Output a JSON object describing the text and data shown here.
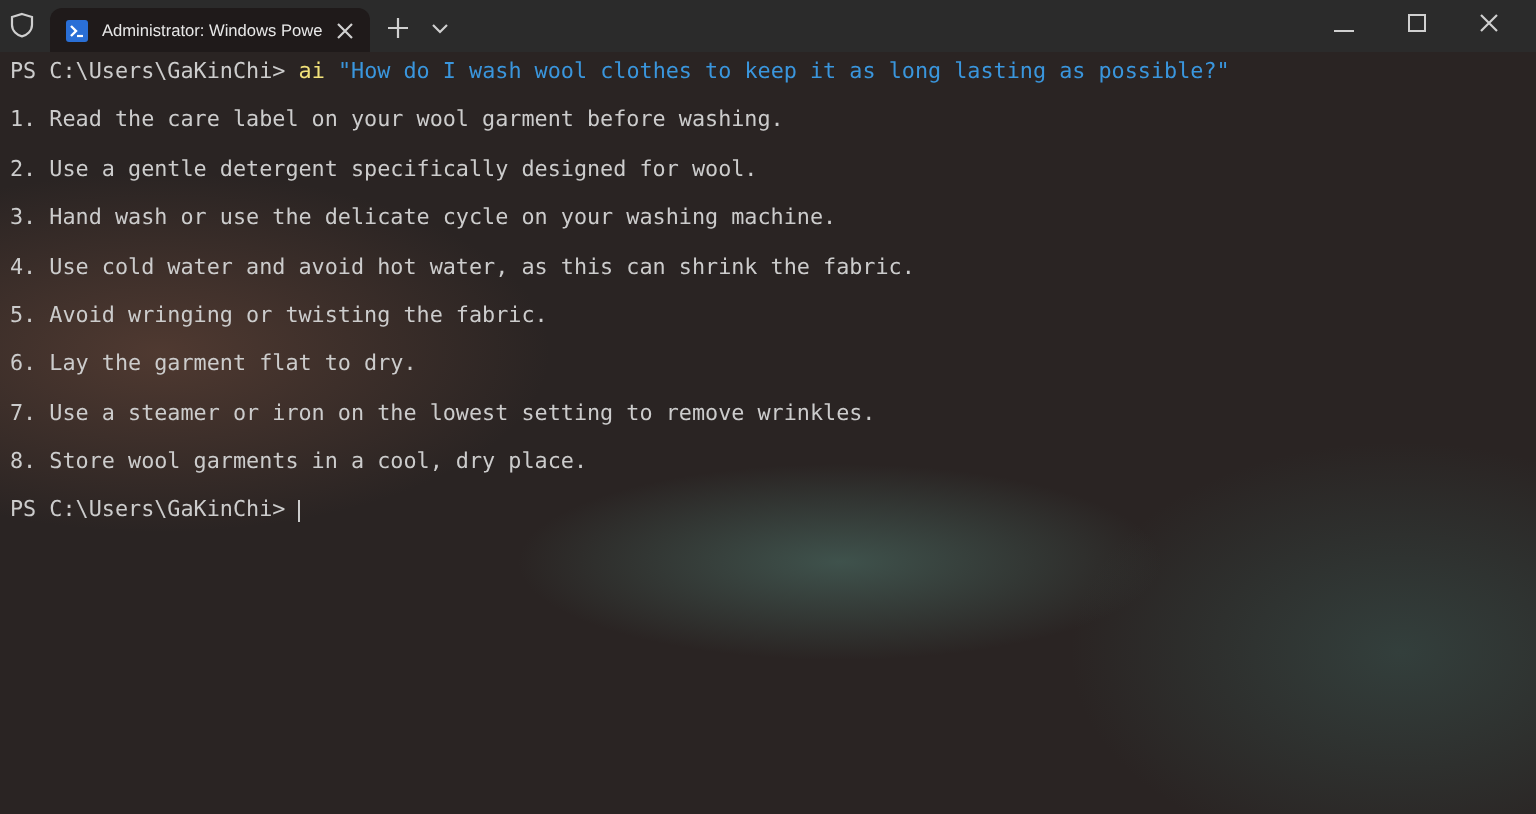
{
  "tabs": [
    {
      "title": "Administrator: Windows Powe",
      "selected": true
    }
  ],
  "terminal": {
    "command": {
      "prompt": "PS C:\\Users\\GaKinChi>",
      "program": "ai",
      "argument": "\"How do I wash wool clothes to keep it as long lasting as possible?\""
    },
    "output": [
      "1. Read the care label on your wool garment before washing.",
      "2. Use a gentle detergent specifically designed for wool.",
      "3. Hand wash or use the delicate cycle on your washing machine.",
      "4. Use cold water and avoid hot water, as this can shrink the fabric.",
      "5. Avoid wringing or twisting the fabric.",
      "6. Lay the garment flat to dry.",
      "7. Use a steamer or iron on the lowest setting to remove wrinkles.",
      "8. Store wool garments in a cool, dry place."
    ],
    "final_prompt": "PS C:\\Users\\GaKinChi>"
  }
}
